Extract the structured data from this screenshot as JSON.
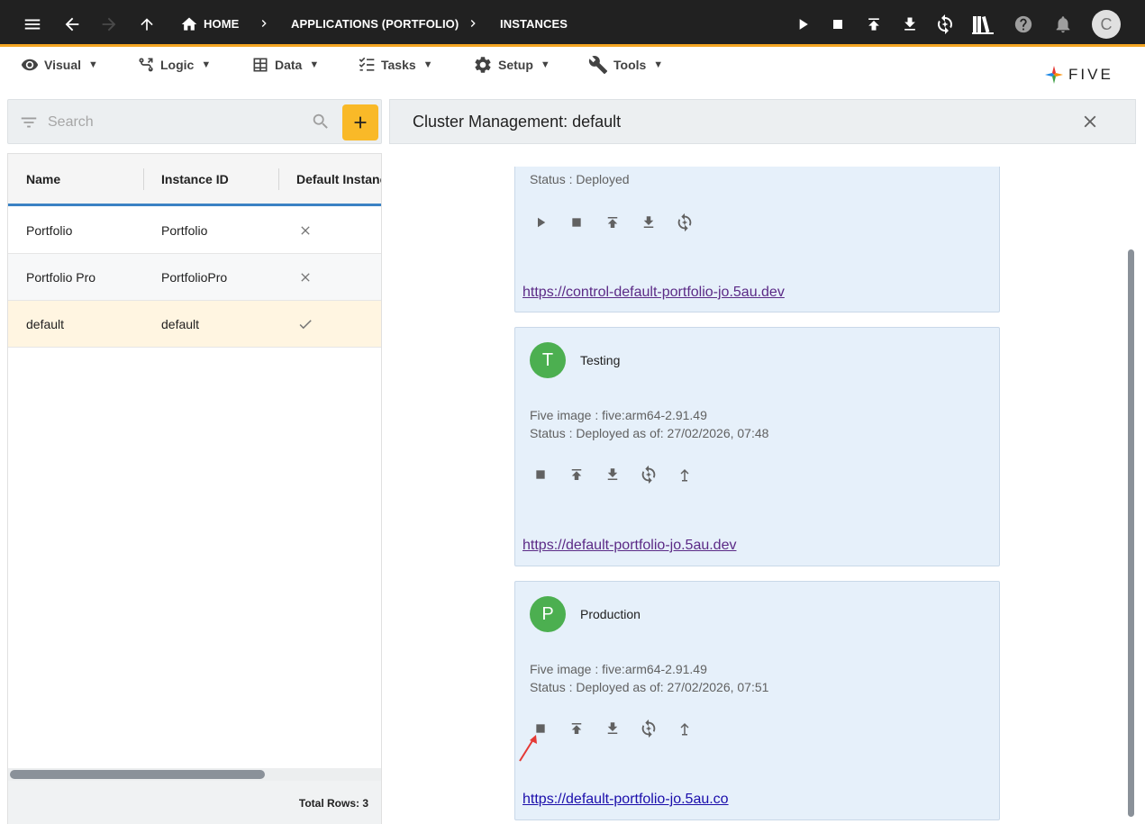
{
  "topbar": {
    "breadcrumbs": [
      "HOME",
      "APPLICATIONS (PORTFOLIO)",
      "INSTANCES"
    ],
    "avatar_initial": "C",
    "accent_color": "#f5a623"
  },
  "menu": {
    "items": [
      {
        "label": "Visual",
        "icon": "eye-icon"
      },
      {
        "label": "Logic",
        "icon": "logic-icon"
      },
      {
        "label": "Data",
        "icon": "table-icon"
      },
      {
        "label": "Tasks",
        "icon": "tasks-icon"
      },
      {
        "label": "Setup",
        "icon": "gear-icon"
      },
      {
        "label": "Tools",
        "icon": "tools-icon"
      }
    ],
    "caret": "▼"
  },
  "logo": {
    "text": "FIVE"
  },
  "list": {
    "search_placeholder": "Search",
    "add_color": "#f9b928",
    "columns": [
      "Name",
      "Instance ID",
      "Default Instance"
    ],
    "rows": [
      {
        "name": "Portfolio",
        "instance_id": "Portfolio",
        "default": false
      },
      {
        "name": "Portfolio Pro",
        "instance_id": "PortfolioPro",
        "default": false
      },
      {
        "name": "default",
        "instance_id": "default",
        "default": true
      }
    ],
    "total_rows": "Total Rows: 3"
  },
  "cluster": {
    "title": "Cluster Management: default",
    "cards": [
      {
        "status": "Status : Deployed",
        "url": "https://control-default-portfolio-jo.5au.dev"
      },
      {
        "initial": "T",
        "name": "Testing",
        "image": "Five image : five:arm64-2.91.49",
        "status": "Status : Deployed as of: 27/02/2026, 07:48",
        "url": "https://default-portfolio-jo.5au.dev"
      },
      {
        "initial": "P",
        "name": "Production",
        "image": "Five image : five:arm64-2.91.49",
        "status": "Status : Deployed as of: 27/02/2026, 07:51",
        "url": "https://default-portfolio-jo.5au.co"
      }
    ]
  }
}
